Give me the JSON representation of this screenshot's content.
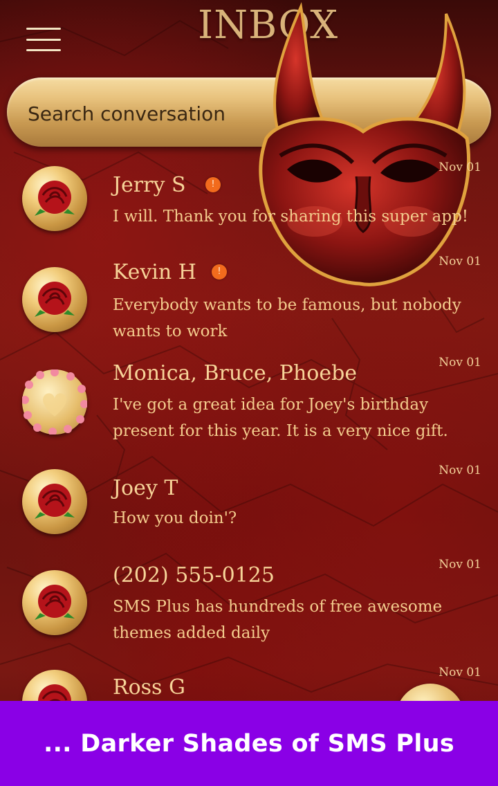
{
  "header": {
    "title": "INBOX",
    "menu_icon": "hamburger-menu-icon"
  },
  "search": {
    "placeholder": "Search conversation"
  },
  "conversations": [
    {
      "name": "Jerry S",
      "preview": "I will. Thank you for sharing this super app!",
      "date": "Nov 01",
      "unread_badge": "!",
      "avatar": "rose-icon"
    },
    {
      "name": "Kevin H",
      "preview": "Everybody wants to be famous, but nobody wants to work",
      "date": "Nov 01",
      "unread_badge": "!",
      "avatar": "rose-icon"
    },
    {
      "name": "Monica, Bruce, Phoebe",
      "preview": "I've got a great idea for Joey's birthday present for this year. It is a very nice gift.",
      "date": "Nov 01",
      "avatar": "heart-wreath-icon"
    },
    {
      "name": "Joey T",
      "preview": "How you doin'?",
      "date": "Nov 01",
      "avatar": "rose-icon"
    },
    {
      "name": "(202) 555-0125",
      "preview": "SMS Plus has hundreds of free awesome themes added daily",
      "date": "Nov 01",
      "avatar": "rose-icon"
    },
    {
      "name": "Ross G",
      "preview": "",
      "date": "Nov 01",
      "avatar": "rose-icon"
    }
  ],
  "banner": {
    "text": "... Darker Shades of SMS Plus"
  },
  "colors": {
    "accent_gold": "#d9b37a",
    "banner": "#8a00e6",
    "badge": "#f26b1d"
  }
}
